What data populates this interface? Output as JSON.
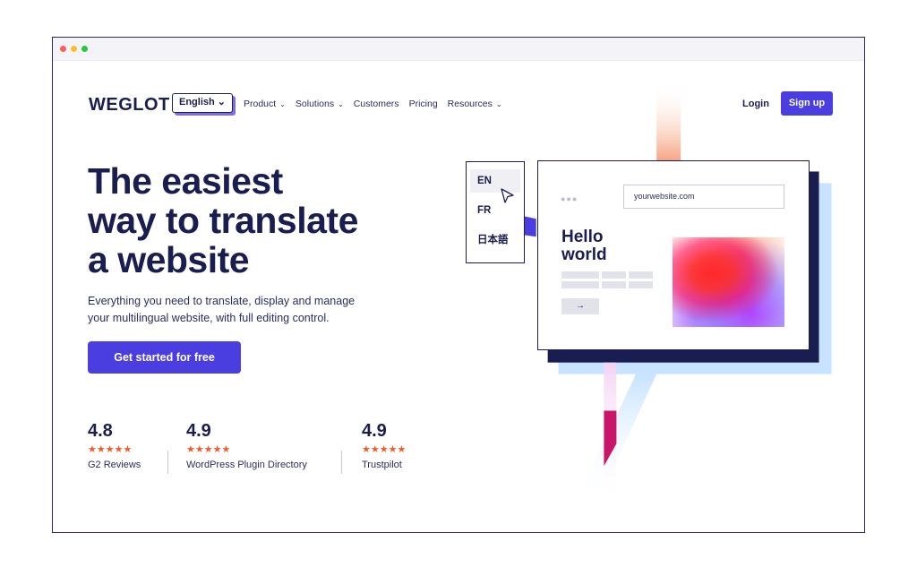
{
  "window": {
    "controls": [
      "close",
      "minimize",
      "maximize"
    ]
  },
  "nav": {
    "logo": "WEGLOT",
    "language": "English ⌄",
    "items": [
      {
        "label": "Product",
        "has_menu": true
      },
      {
        "label": "Solutions",
        "has_menu": true
      },
      {
        "label": "Customers",
        "has_menu": false
      },
      {
        "label": "Pricing",
        "has_menu": false
      },
      {
        "label": "Resources",
        "has_menu": true
      }
    ],
    "chevron": "⌄",
    "login": "Login",
    "signup": "Sign up"
  },
  "hero": {
    "title_lines": [
      "The easiest",
      "way to translate",
      "a website"
    ],
    "subtitle_lines": [
      "Everything you need to translate, display and manage",
      "your multilingual website, with full editing control."
    ],
    "cta": "Get started for free"
  },
  "ratings": [
    {
      "score": "4.8",
      "stars": "★★★★★",
      "source": "G2 Reviews"
    },
    {
      "score": "4.9",
      "stars": "★★★★★",
      "source": "WordPress Plugin Directory"
    },
    {
      "score": "4.9",
      "stars": "★★★★★",
      "source": "Trustpilot"
    }
  ],
  "illustration": {
    "languages": [
      "EN",
      "FR",
      "日本語"
    ],
    "selected_language": "EN",
    "url": "yourwebsite.com",
    "mini_dots": "●●●",
    "heading_lines": [
      "Hello",
      "world"
    ],
    "arrow": "→"
  },
  "colors": {
    "brand_dark": "#1a1d4f",
    "accent": "#4a3ee0",
    "stars": "#ef5b2a",
    "light_blue": "#c7e3ff",
    "orange_bar": "#f5a07c",
    "pink": "#c8166a"
  }
}
